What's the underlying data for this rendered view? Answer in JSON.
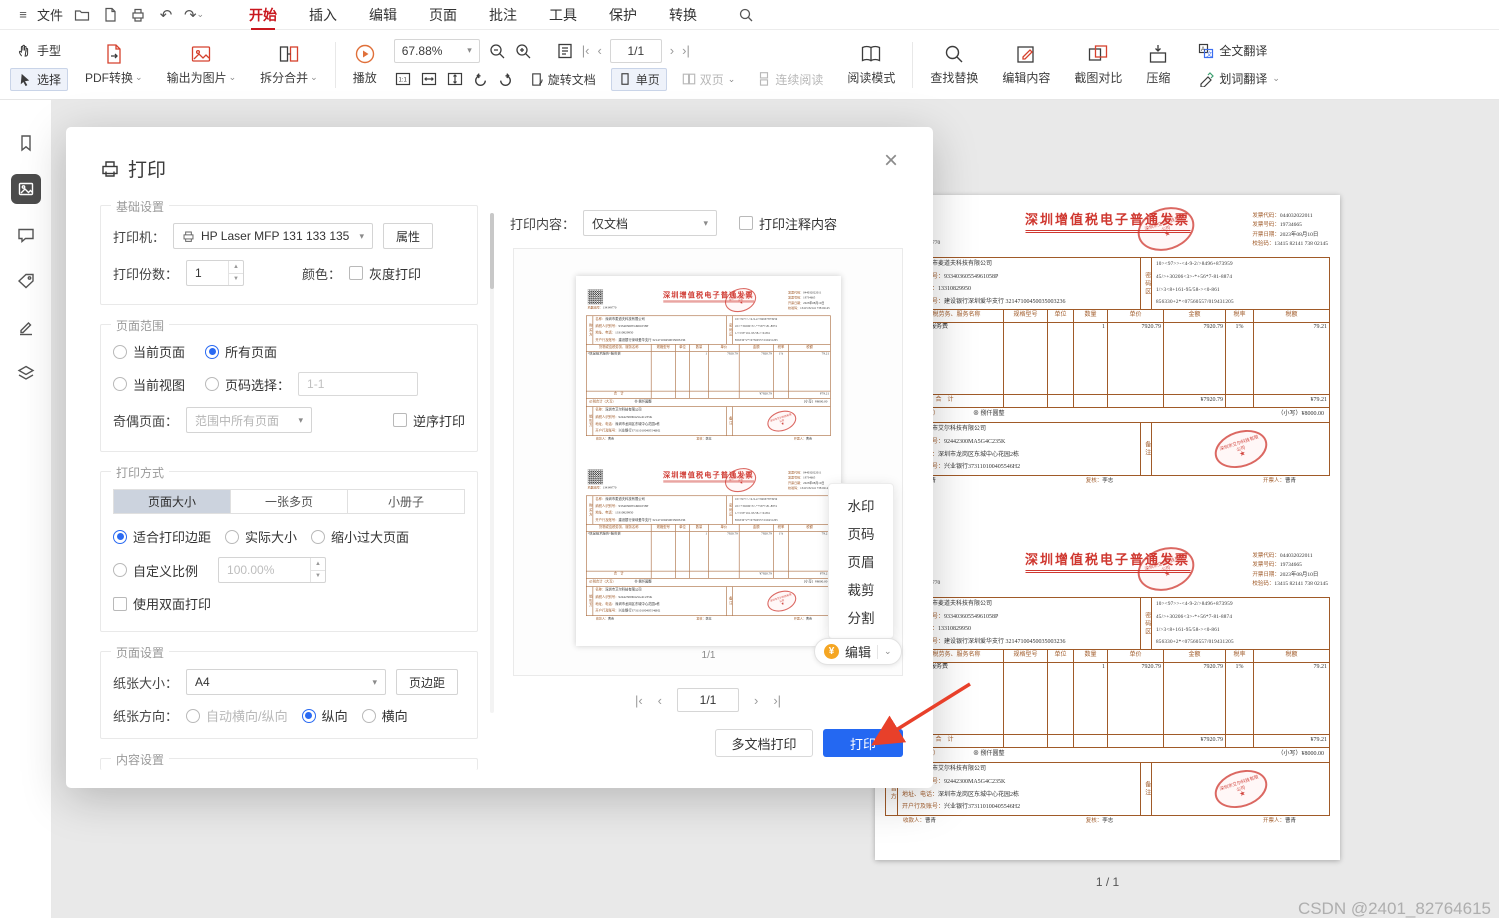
{
  "menubar": {
    "file": "文件",
    "tabs": [
      "开始",
      "插入",
      "编辑",
      "页面",
      "批注",
      "工具",
      "保护",
      "转换"
    ]
  },
  "toolbar": {
    "hand": "手型",
    "select": "选择",
    "pdf_convert": "PDF转换",
    "export_image": "输出为图片",
    "split_merge": "拆分合并",
    "play": "播放",
    "zoom": "67.88%",
    "page_box": "1/1",
    "rotate_doc": "旋转文档",
    "single_page": "单页",
    "double_page": "双页",
    "continuous": "连续阅读",
    "read_mode": "阅读模式",
    "find_replace": "查找替换",
    "edit_content": "编辑内容",
    "shot_compare": "截图对比",
    "compress": "压缩",
    "translate_full": "全文翻译",
    "translate_word": "划词翻译"
  },
  "dialog": {
    "title": "打印",
    "basic": {
      "label": "基础设置",
      "printer_label": "打印机：",
      "printer_value": "HP Laser MFP 131 133 135",
      "properties": "属性",
      "copies_label": "打印份数：",
      "copies_value": "1",
      "color_label": "颜色：",
      "grayscale": "灰度打印"
    },
    "range": {
      "label": "页面范围",
      "current_page": "当前页面",
      "all_pages": "所有页面",
      "current_view": "当前视图",
      "page_select": "页码选择：",
      "page_select_value": "1-1",
      "odd_even_label": "奇偶页面：",
      "odd_even_value": "范围中所有页面",
      "reverse": "逆序打印"
    },
    "method": {
      "label": "打印方式",
      "tabs": [
        "页面大小",
        "一张多页",
        "小册子"
      ],
      "fit_margin": "适合打印边距",
      "actual_size": "实际大小",
      "shrink": "缩小过大页面",
      "custom_scale": "自定义比例",
      "scale_value": "100.00%",
      "duplex": "使用双面打印"
    },
    "page": {
      "label": "页面设置",
      "paper_label": "纸张大小：",
      "paper_value": "A4",
      "margins": "页边距",
      "orient_label": "纸张方向：",
      "auto_orient": "自动横向/纵向",
      "portrait": "纵向",
      "landscape": "横向"
    },
    "content_label": "内容设置",
    "preview": {
      "print_content_label": "打印内容：",
      "print_content_value": "仅文档",
      "annotations": "打印注释内容",
      "page_label": "1/1",
      "side_tools": [
        "水印",
        "页码",
        "页眉",
        "裁剪",
        "分割"
      ],
      "edit": "编辑",
      "nav_value": "1/1"
    },
    "multi_doc": "多文档打印",
    "print": "打印"
  },
  "invoice": {
    "title": "深圳增值税电子普通发票",
    "machine_label": "机器编号：",
    "machine_no": "134349770",
    "code_label": "发票代码：",
    "code": "044032022011",
    "number_label": "发票号码：",
    "number": "19734665",
    "date_label": "开票日期：",
    "date": "2023年08月10日",
    "check_label": "校验码：",
    "check": "13415 82141 738 02145",
    "buyer_label": "购买方",
    "seller_label": "销售方",
    "password_label": "密码区",
    "remark_label": "备注",
    "f_name": "名称：",
    "f_tax": "纳税人识别号：",
    "f_addr": "地址、电话：",
    "f_bank": "开户行及账号：",
    "buyer": {
      "name": "深圳市麦道夫科技有限公司",
      "tax_id": "93340360554961058P",
      "address": "13310829950",
      "bank": "建设银行深圳爱华支行 32147100450035003236"
    },
    "password_area": [
      "10><97>>-<4-9-2/>8496+873959",
      "45/>+30206<3>-*+56*7-81-8874",
      "1/>3<8+161-95/58-><0-861",
      "856330+2*<07560557/019431205"
    ],
    "table": {
      "headers": [
        "货物或应税劳务、服务名称",
        "规格型号",
        "单位",
        "数量",
        "单价",
        "金额",
        "税率",
        "税额"
      ],
      "row_name": "*信息技术服务*服务费",
      "row_qty": "1",
      "row_price": "7920.79",
      "row_amount": "7920.79",
      "row_rate": "1%",
      "row_tax": "79.21",
      "total_label": "合　计",
      "total_amount": "¥7920.79",
      "total_tax": "¥79.21"
    },
    "sum_label": "价税合计（大写）",
    "sum_cn": "⊗ 捌仟圆整",
    "sum_small": "（小写）¥8000.00",
    "seller": {
      "name": "深圳市艾尔科技有限公司",
      "tax_id": "92442300MA5G4C235K",
      "address": "深圳市龙岗区东城中心花园2栋",
      "bank": "兴业银行373110100405546H2"
    },
    "stamp_text": "深圳市艾尔科技有限公司",
    "foot_payee_label": "收款人：",
    "foot_payee": "曹青",
    "foot_review_label": "复核：",
    "foot_review": "李志",
    "foot_drawer_label": "开票人：",
    "foot_drawer": "曹青"
  },
  "doc": {
    "page_indicator": "1 / 1"
  },
  "watermark": "CSDN @2401_82764615",
  "icons": {
    "hamburger": "≡",
    "undo": "↶",
    "redo": "↷",
    "chevron_small": "▾",
    "chevron_down": "⌄",
    "close": "×",
    "spin_up": "▲",
    "spin_down": "▼",
    "nav_first": "|‹",
    "nav_prev": "‹",
    "nav_next": "›",
    "nav_last": "›|",
    "coin": "¥",
    "star": "★"
  },
  "colors": {
    "accent_red": "#c9171e",
    "primary_blue": "#2468f2",
    "invoice_brown": "#a05a28",
    "stamp_red": "#cf3830"
  }
}
